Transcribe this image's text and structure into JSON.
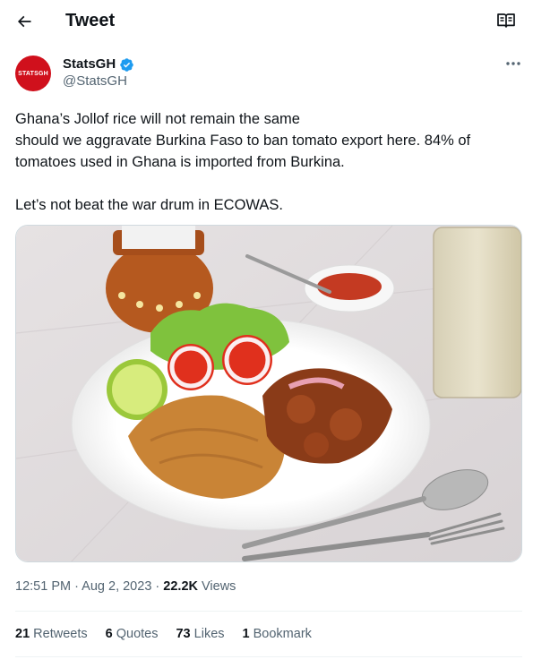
{
  "header": {
    "title": "Tweet"
  },
  "author": {
    "display_name": "StatsGH",
    "handle": "@StatsGH",
    "avatar_text": "STATSGH",
    "avatar_color": "#d0101c"
  },
  "tweet": {
    "lines": [
      "Ghana’s Jollof rice will not remain the same",
      "should we aggravate Burkina Faso to ban tomato export here. 84% of tomatoes used in Ghana is imported from Burkina."
    ],
    "closing": "Let’s not beat the war drum in ECOWAS."
  },
  "meta": {
    "time": "12:51 PM",
    "date": "Aug 2, 2023",
    "views_count": "22.2K",
    "views_label": "Views"
  },
  "stats": {
    "retweets_count": "21",
    "retweets_label": "Retweets",
    "quotes_count": "6",
    "quotes_label": "Quotes",
    "likes_count": "73",
    "likes_label": "Likes",
    "bookmarks_count": "1",
    "bookmarks_label": "Bookmark"
  },
  "colors": {
    "verified": "#1d9bf0",
    "secondary_text": "#536471"
  },
  "icons": [
    "back-arrow-icon",
    "reader-mode-icon",
    "verified-badge-icon",
    "more-options-icon"
  ]
}
